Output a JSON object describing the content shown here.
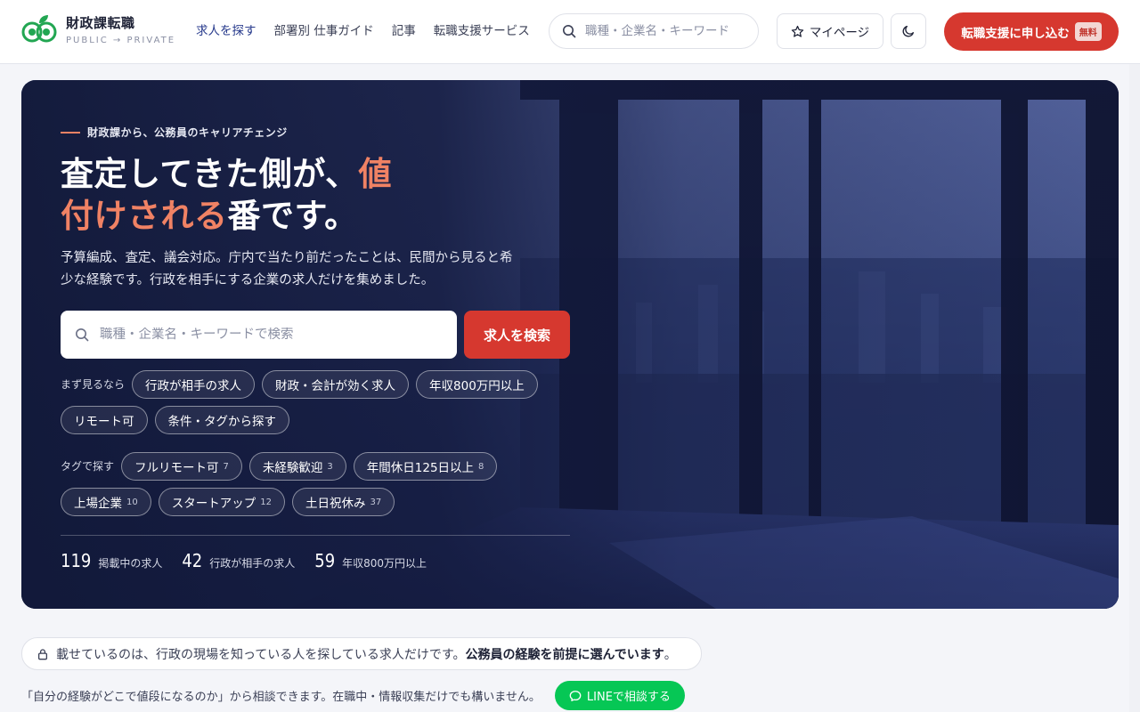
{
  "header": {
    "logo_title": "財政課転職",
    "logo_sub": "PUBLIC → PRIVATE",
    "nav": [
      "求人を探す",
      "部署別 仕事ガイド",
      "記事",
      "転職支援サービス"
    ],
    "search_placeholder": "職種・企業名・キーワード",
    "mypage_label": "マイページ",
    "apply_label": "転職支援に申し込む",
    "apply_badge": "無料"
  },
  "hero": {
    "eyebrow": "財政課から、公務員のキャリアチェンジ",
    "title_part1": "査定してきた側が、",
    "title_accent_a": "値",
    "title_accent_b": "付けされる",
    "title_part2": "番です。",
    "description": "予算編成、査定、議会対応。庁内で当たり前だったことは、民間から見ると希少な経験です。行政を相手にする企業の求人だけを集めました。",
    "search_placeholder": "職種・企業名・キーワードで検索",
    "search_button": "求人を検索",
    "quick_label": "まず見るなら",
    "quick_chips": [
      "行政が相手の求人",
      "財政・会計が効く求人",
      "年収800万円以上",
      "リモート可",
      "条件・タグから探す"
    ],
    "tag_label": "タグで探す",
    "tags": [
      {
        "label": "フルリモート可",
        "count": "7"
      },
      {
        "label": "未経験歓迎",
        "count": "3"
      },
      {
        "label": "年間休日125日以上",
        "count": "8"
      },
      {
        "label": "上場企業",
        "count": "10"
      },
      {
        "label": "スタートアップ",
        "count": "12"
      },
      {
        "label": "土日祝休み",
        "count": "37"
      }
    ],
    "stats": [
      {
        "num": "119",
        "label": "掲載中の求人"
      },
      {
        "num": "42",
        "label": "行政が相手の求人"
      },
      {
        "num": "59",
        "label": "年収800万円以上"
      }
    ]
  },
  "notice": {
    "text": "載せているのは、行政の現場を知っている人を探している求人だけです。",
    "bold": "公務員の経験を前提に選んでいます",
    "end": "。"
  },
  "consult": {
    "text": "「自分の経験がどこで値段になるのか」から相談できます。在職中・情報収集だけでも構いません。",
    "line_button": "LINEで相談する"
  },
  "colors": {
    "brand_red": "#d6382f",
    "accent_orange": "#f08264",
    "nav_blue": "#273a8c",
    "line_green": "#06c755",
    "logo_green": "#22a652"
  }
}
